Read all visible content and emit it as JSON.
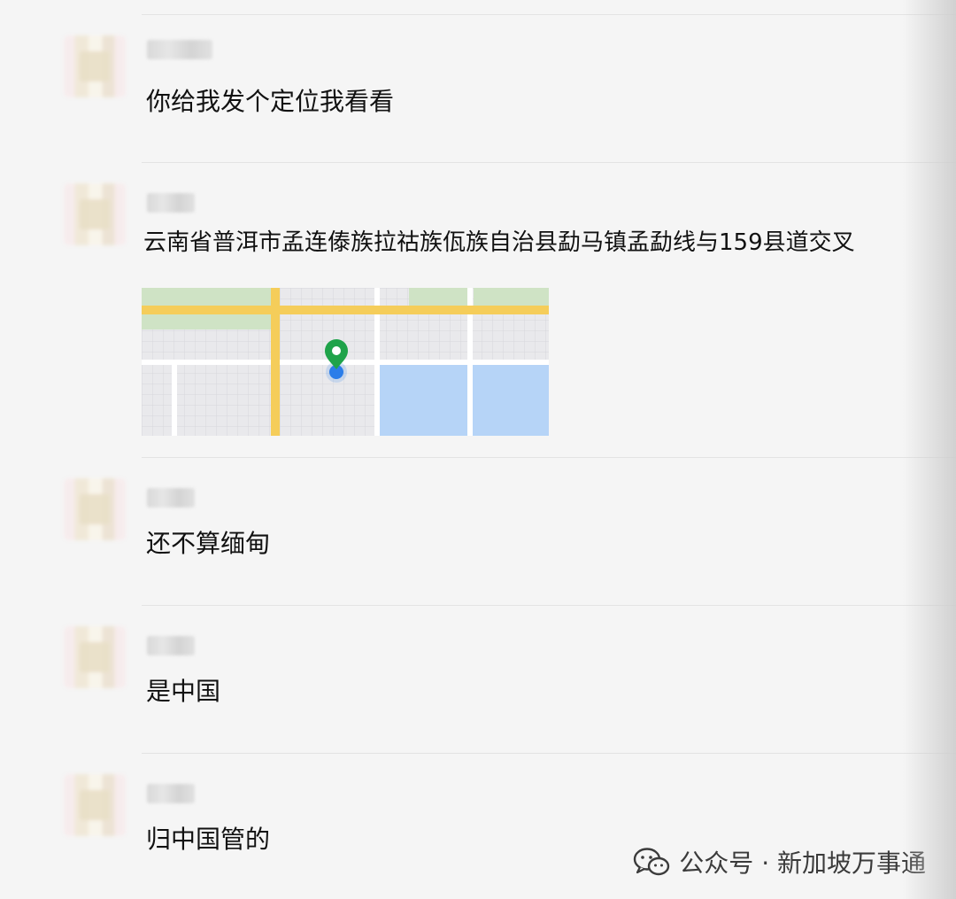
{
  "messages": [
    {
      "text": "你给我发个定位我看看"
    },
    {
      "text": "云南省普洱市孟连傣族拉祜族佤族自治县勐马镇孟勐线与159县道交叉"
    },
    {
      "text": "还不算缅甸"
    },
    {
      "text": "是中国"
    },
    {
      "text": "归中国管的"
    }
  ],
  "watermark": {
    "text": "公众号 · 新加坡万事通",
    "icon": "wechat-icon"
  },
  "colors": {
    "background": "#f5f5f5",
    "map_road": "#f5cd5a",
    "map_park": "#cfe3c5",
    "map_water": "#b6d4f7",
    "pin_green": "#1fa34a",
    "location_dot": "#2b7de9"
  }
}
